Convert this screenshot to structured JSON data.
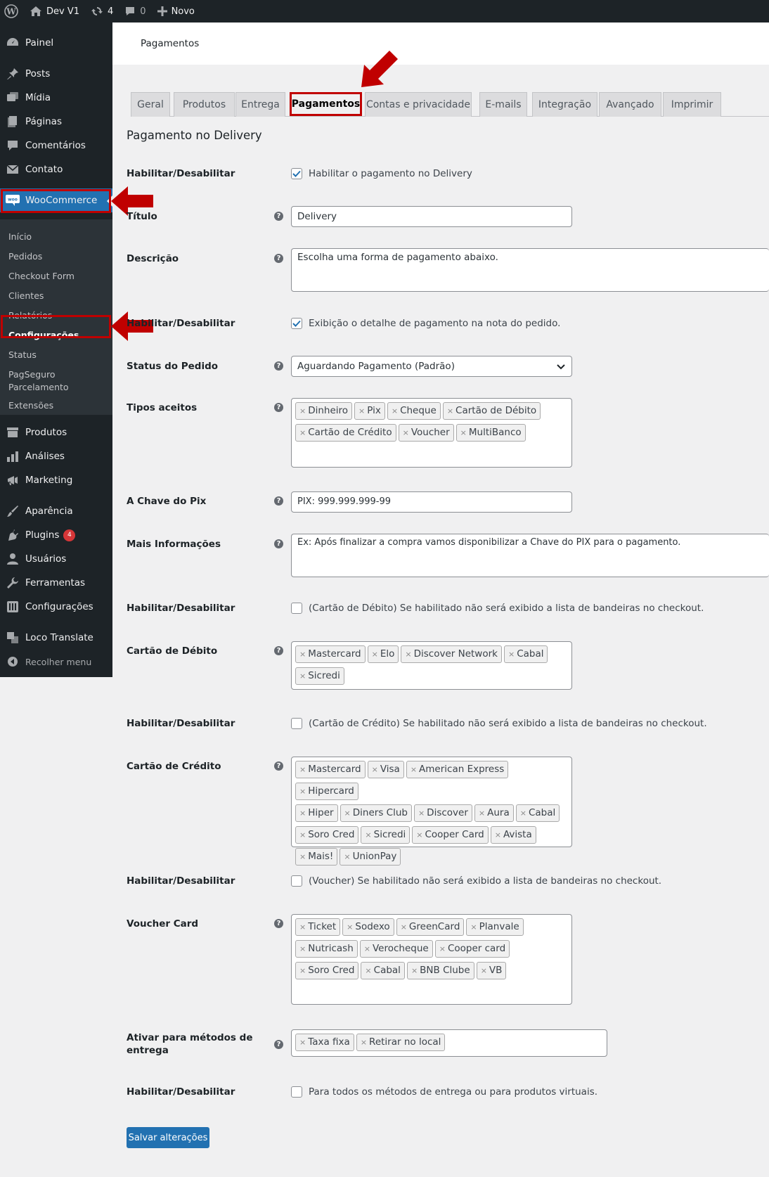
{
  "adminbar": {
    "site_name": "Dev V1",
    "updates": "4",
    "comments": "0",
    "new": "Novo"
  },
  "sidebar": {
    "items": [
      "Painel",
      "Posts",
      "Mídia",
      "Páginas",
      "Comentários",
      "Contato",
      "WooCommerce",
      "Produtos",
      "Análises",
      "Marketing",
      "Aparência",
      "Plugins",
      "Usuários",
      "Ferramentas",
      "Configurações",
      "Loco Translate",
      "Recolher menu"
    ],
    "plugins_badge": "4",
    "woo_submenu": [
      "Início",
      "Pedidos",
      "Checkout Form",
      "Clientes",
      "Relatórios",
      "Configurações",
      "Status",
      "PagSeguro",
      "Parcelamento",
      "Extensões"
    ]
  },
  "header": {
    "title": "Pagamentos"
  },
  "tabs": [
    "Geral",
    "Produtos",
    "Entrega",
    "Pagamentos",
    "Contas e privacidade",
    "E-mails",
    "Integração",
    "Avançado",
    "Imprimir"
  ],
  "form": {
    "section_title": "Pagamento no Delivery",
    "labels": {
      "enable1": "Habilitar/Desabilitar",
      "titulo": "Título",
      "descricao": "Descrição",
      "enable2": "Habilitar/Desabilitar",
      "status": "Status do Pedido",
      "tipos": "Tipos aceitos",
      "pix": "A Chave do Pix",
      "mais": "Mais Informações",
      "enable3": "Habilitar/Desabilitar",
      "debito": "Cartão de Débito",
      "enable4": "Habilitar/Desabilitar",
      "credito": "Cartão de Crédito",
      "enable5": "Habilitar/Desabilitar",
      "voucher": "Voucher Card",
      "metodos": "Ativar para métodos de entrega",
      "enable6": "Habilitar/Desabilitar"
    },
    "check1": "Habilitar o pagamento no Delivery",
    "titulo_value": "Delivery",
    "descricao_value": "Escolha uma forma de pagamento abaixo.",
    "check2": "Exibição o detalhe de pagamento na nota do pedido.",
    "status_value": "Aguardando Pagamento (Padrão)",
    "tipos": [
      "Dinheiro",
      "Pix",
      "Cheque",
      "Cartão de Débito",
      "Cartão de Crédito",
      "Voucher",
      "MultiBanco"
    ],
    "pix_value": "PIX: 999.999.999-99",
    "mais_value": "Ex: Após finalizar a compra vamos disponibilizar a Chave do PIX para o pagamento.",
    "check3": "(Cartão de Débito) Se habilitado não será exibido a lista de bandeiras no checkout.",
    "debito": [
      "Mastercard",
      "Elo",
      "Discover Network",
      "Cabal",
      "Sicredi"
    ],
    "check4": "(Cartão de Crédito) Se habilitado não será exibido a lista de bandeiras no checkout.",
    "credito": [
      "Mastercard",
      "Visa",
      "American Express",
      "Hipercard",
      "Hiper",
      "Diners Club",
      "Discover",
      "Aura",
      "Cabal",
      "Soro Cred",
      "Sicredi",
      "Cooper Card",
      "Avista",
      "Mais!",
      "UnionPay"
    ],
    "check5": "(Voucher) Se habilitado não será exibido a lista de bandeiras no checkout.",
    "voucher": [
      "Ticket",
      "Sodexo",
      "GreenCard",
      "Planvale",
      "Nutricash",
      "Verocheque",
      "Cooper card",
      "Soro Cred",
      "Cabal",
      "BNB Clube",
      "VB"
    ],
    "metodos": [
      "Taxa fixa",
      "Retirar no local"
    ],
    "check6": "Para todos os métodos de entrega ou para produtos virtuais.",
    "save": "Salvar alterações"
  }
}
